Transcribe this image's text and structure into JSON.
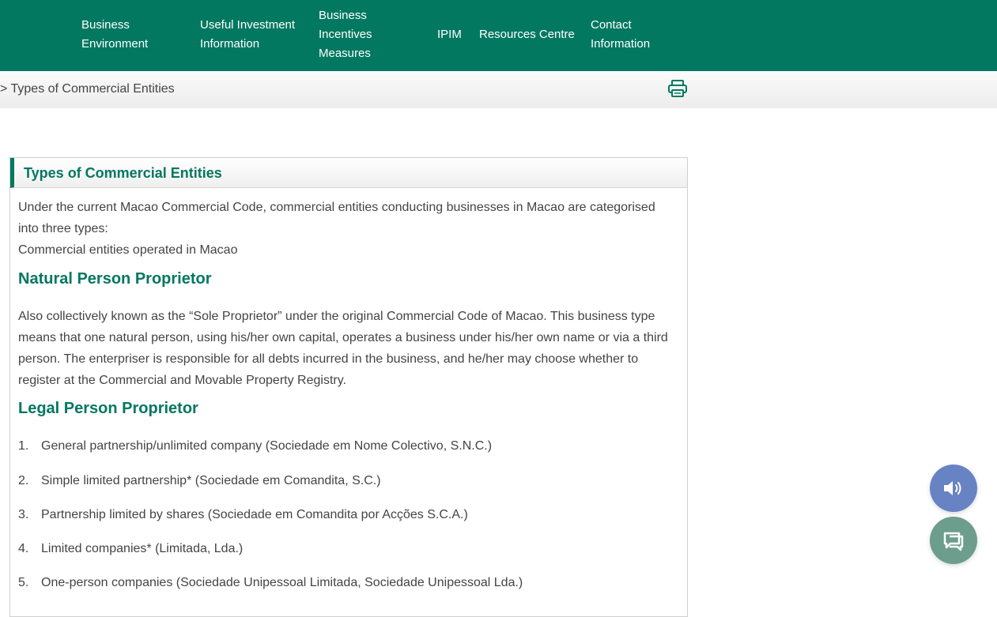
{
  "nav": {
    "items": [
      {
        "label": "Business\nEnvironment"
      },
      {
        "label": "Useful Investment\nInformation"
      },
      {
        "label": "Business\nIncentives\nMeasures"
      },
      {
        "label": "IPIM"
      },
      {
        "label": "Resources Centre"
      },
      {
        "label": "Contact\nInformation"
      }
    ]
  },
  "breadcrumb": {
    "text": "> Types of Commercial Entities"
  },
  "icons": {
    "print": "print-icon",
    "speaker": "speaker-icon",
    "chat": "chat-icon"
  },
  "colors": {
    "brand": "#037860",
    "speaker_fab": "#6783c4",
    "chat_fab": "#6c9d8d"
  },
  "panel": {
    "title": "Types of Commercial Entities",
    "intro_1": "Under the current Macao Commercial Code, commercial entities conducting businesses in Macao are categorised into three types:",
    "intro_2": "Commercial entities operated in Macao",
    "section1": {
      "heading": "Natural Person Proprietor",
      "text": "Also collectively known as the “Sole Proprietor” under the original Commercial Code of Macao. This business type means that one natural person, using his/her own capital, operates a business under his/her own name or via a third person. The enterpriser is responsible for all debts incurred in the business, and he/her may choose whether to register at the Commercial and Movable Property Registry."
    },
    "section2": {
      "heading": "Legal Person Proprietor",
      "items": [
        {
          "num": "1.",
          "text": "General partnership/unlimited company (Sociedade em Nome Colectivo, S.N.C.)"
        },
        {
          "num": "2.",
          "text": "Simple limited partnership* (Sociedade em Comandita, S.C.)"
        },
        {
          "num": "3.",
          "text": "Partnership limited by shares (Sociedade em Comandita por Acções S.C.A.)"
        },
        {
          "num": "4.",
          "text": "Limited companies* (Limitada, Lda.)"
        },
        {
          "num": "5.",
          "text": "One-person companies (Sociedade Unipessoal Limitada, Sociedade Unipessoal Lda.)"
        }
      ]
    }
  }
}
